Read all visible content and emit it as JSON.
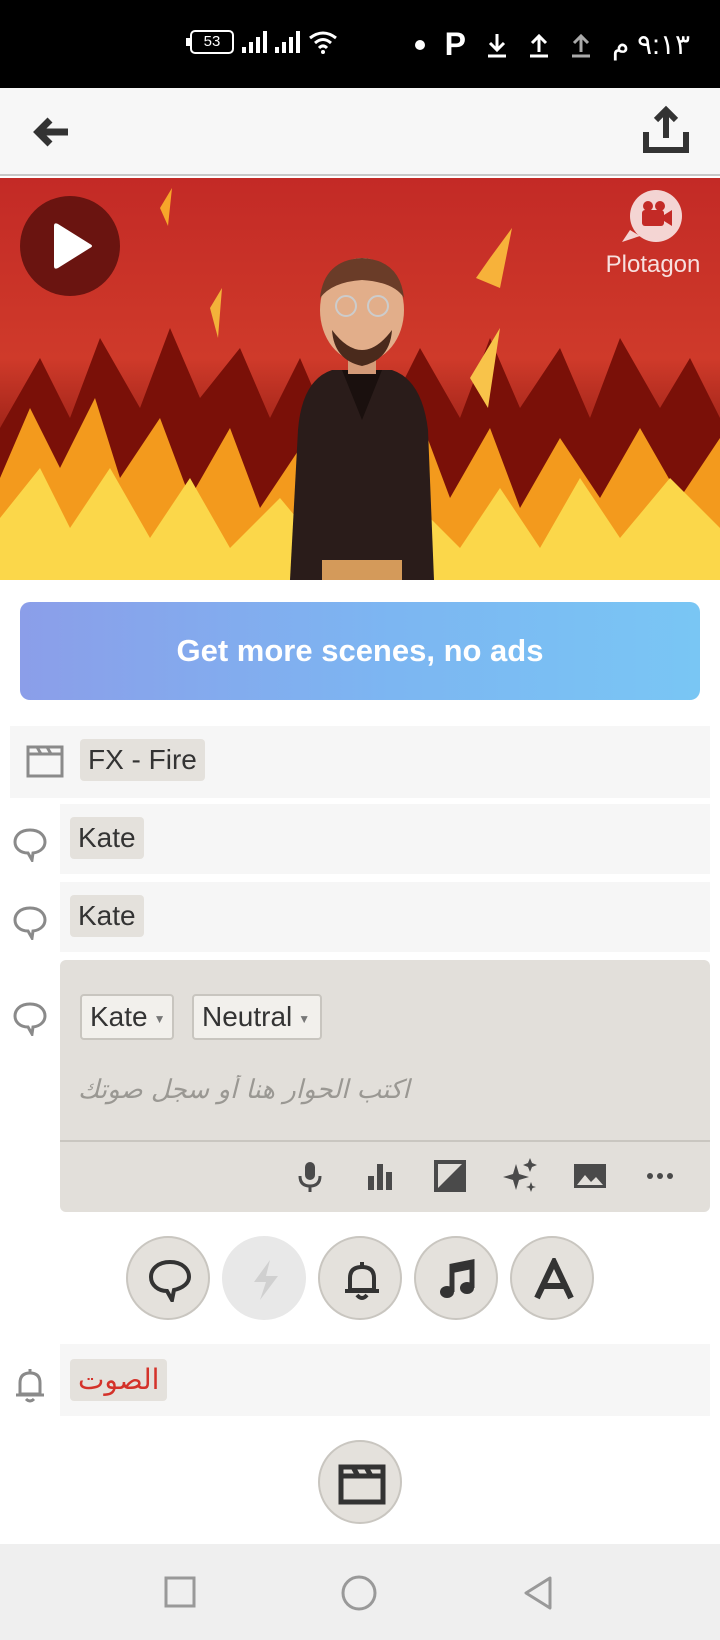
{
  "status_bar": {
    "time": "٩:١٣ م",
    "battery": "53"
  },
  "preview": {
    "watermark": "Plotagon"
  },
  "promo": {
    "label": "Get more scenes, no ads"
  },
  "script": {
    "scene_label": "FX - Fire",
    "lines": [
      {
        "character": "Kate"
      },
      {
        "character": "Kate"
      }
    ],
    "editor": {
      "character": "Kate",
      "emotion": "Neutral",
      "placeholder": "اكتب الحوار هنا أو سجل صوتك"
    },
    "sound_label": "الصوت"
  },
  "colors": {
    "accent_red": "#d4322a",
    "promo_start": "#8b9ee9",
    "promo_end": "#79c6f4"
  }
}
